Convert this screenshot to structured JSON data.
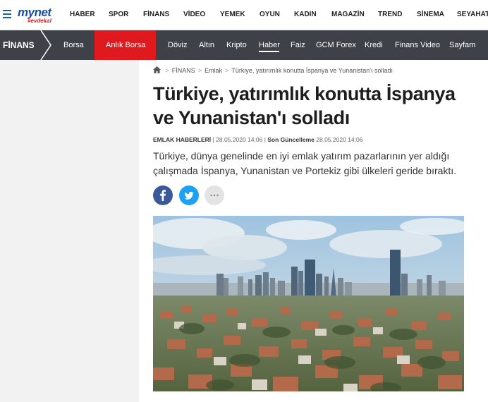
{
  "site": {
    "logo_main": "mynet",
    "logo_sub": "#evdekal"
  },
  "top_nav": [
    "HABER",
    "SPOR",
    "FİNANS",
    "VİDEO",
    "YEMEK",
    "OYUN",
    "KADIN",
    "MAGAZİN",
    "TREND",
    "SİNEMA",
    "SEYAHAT"
  ],
  "finans_bar": {
    "title": "FİNANS",
    "items": [
      "Borsa",
      "Anlık Borsa",
      "Döviz",
      "Altın",
      "Kripto",
      "Haber",
      "Faiz",
      "GCM Forex",
      "Kredi",
      "Finans Video",
      "Sayfam"
    ],
    "active_item": "Haber",
    "highlight_item": "Anlık Borsa",
    "colors": {
      "bar": "#3e4248",
      "highlight": "#e0191f"
    }
  },
  "breadcrumb": {
    "items": [
      "FİNANS",
      "Emlak",
      "Türkiye, yatırımlık konutta İspanya ve Yunanistan'ı solladı"
    ],
    "separator": ">"
  },
  "article": {
    "headline": "Türkiye, yatırımlık konutta İspanya ve Yunanistan'ı solladı",
    "source": "EMLAK HABERLERİ",
    "published": "28.05.2020 14:06",
    "updated_label": "Son Güncelleme",
    "updated": "28.05.2020 14:06",
    "summary": "Türkiye, dünya genelinde en iyi emlak yatırım pazarlarının yer aldığı çalışmada İspanya, Yunanistan ve Portekiz gibi ülkeleri geride bıraktı."
  },
  "share_buttons": [
    {
      "network": "facebook",
      "icon": "facebook-icon",
      "color": "#3b5998"
    },
    {
      "network": "twitter",
      "icon": "twitter-icon",
      "color": "#1da1f2"
    },
    {
      "network": "more",
      "icon": "more-icon",
      "color": "#e4e4e4"
    }
  ]
}
